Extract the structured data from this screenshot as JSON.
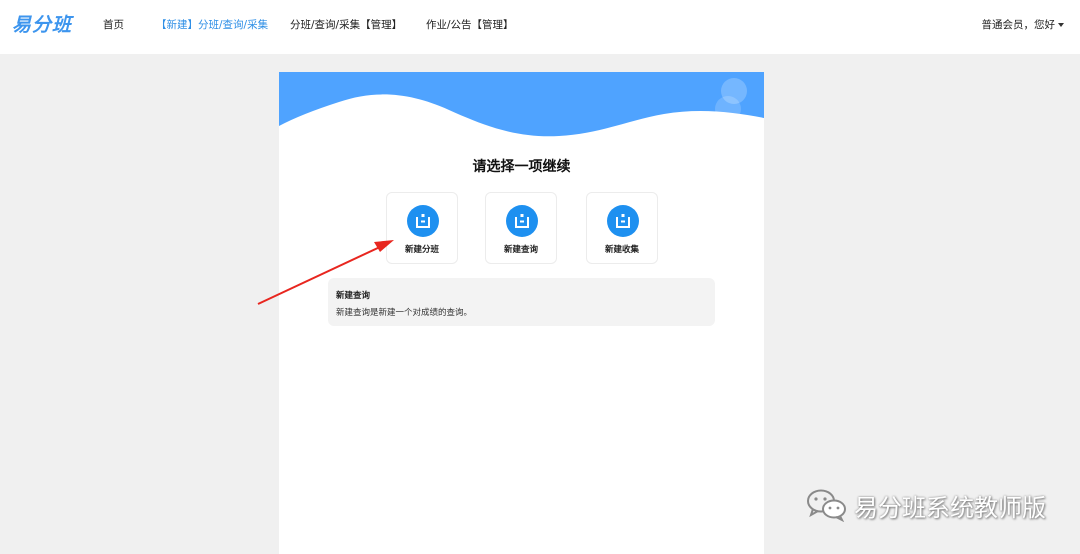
{
  "nav": {
    "brand": "易分班",
    "items": [
      {
        "label": "首页"
      },
      {
        "label": "【新建】分班/查询/采集"
      },
      {
        "label": "分班/查询/采集【管理】"
      },
      {
        "label": "作业/公告【管理】"
      }
    ],
    "user": "普通会员，您好"
  },
  "main": {
    "title": "请选择一项继续",
    "options": [
      {
        "label": "新建分班",
        "icon": "new-item-icon"
      },
      {
        "label": "新建查询",
        "icon": "new-item-icon"
      },
      {
        "label": "新建收集",
        "icon": "new-item-icon"
      }
    ],
    "description": {
      "title": "新建查询",
      "text": "新建查询是新建一个对成绩的查询。"
    }
  },
  "watermark": {
    "text": "易分班系统教师版",
    "icon": "wechat-icon"
  },
  "colors": {
    "brand": "#3d95ee",
    "active_nav": "#2f8fe6",
    "banner": "#4fa3ff",
    "option_icon": "#1e90f0",
    "arrow": "#e8261f"
  }
}
